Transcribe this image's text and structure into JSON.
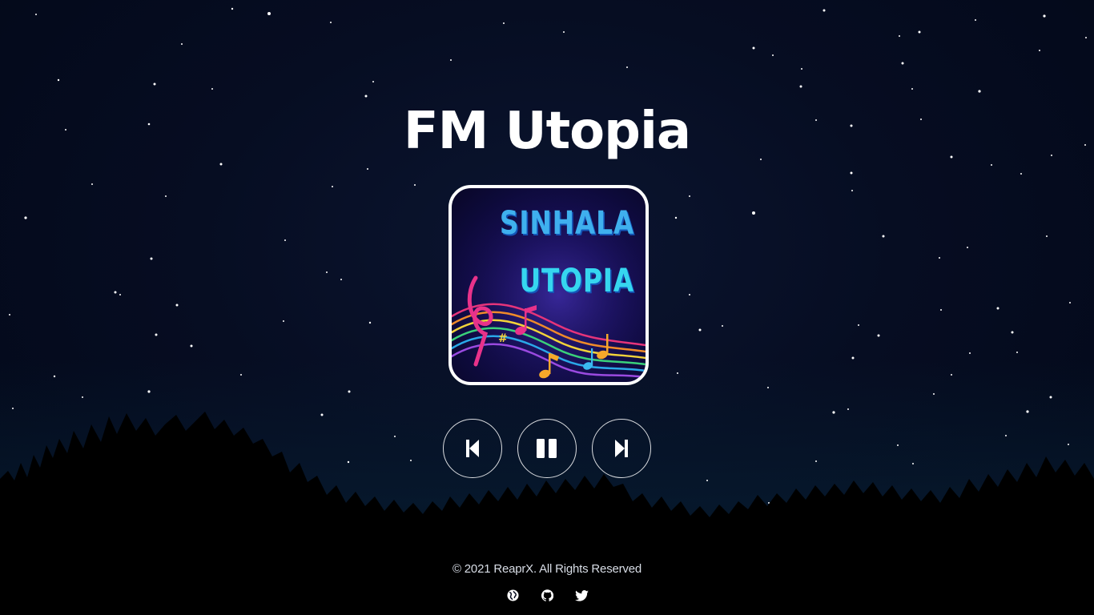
{
  "header": {
    "title": "FM Utopia"
  },
  "album_art": {
    "line1": "SINHALA",
    "line2": "UTOPIA"
  },
  "player": {
    "previous": "previous-icon",
    "pause": "pause-icon",
    "next": "next-icon"
  },
  "footer": {
    "copyright": "© 2021 ReaprX.  All Rights Reserved",
    "links": [
      "globe-icon",
      "github-icon",
      "twitter-icon"
    ]
  },
  "colors": {
    "background": "#050b1f",
    "text": "#ffffff",
    "album_text": "#36c8f0"
  }
}
